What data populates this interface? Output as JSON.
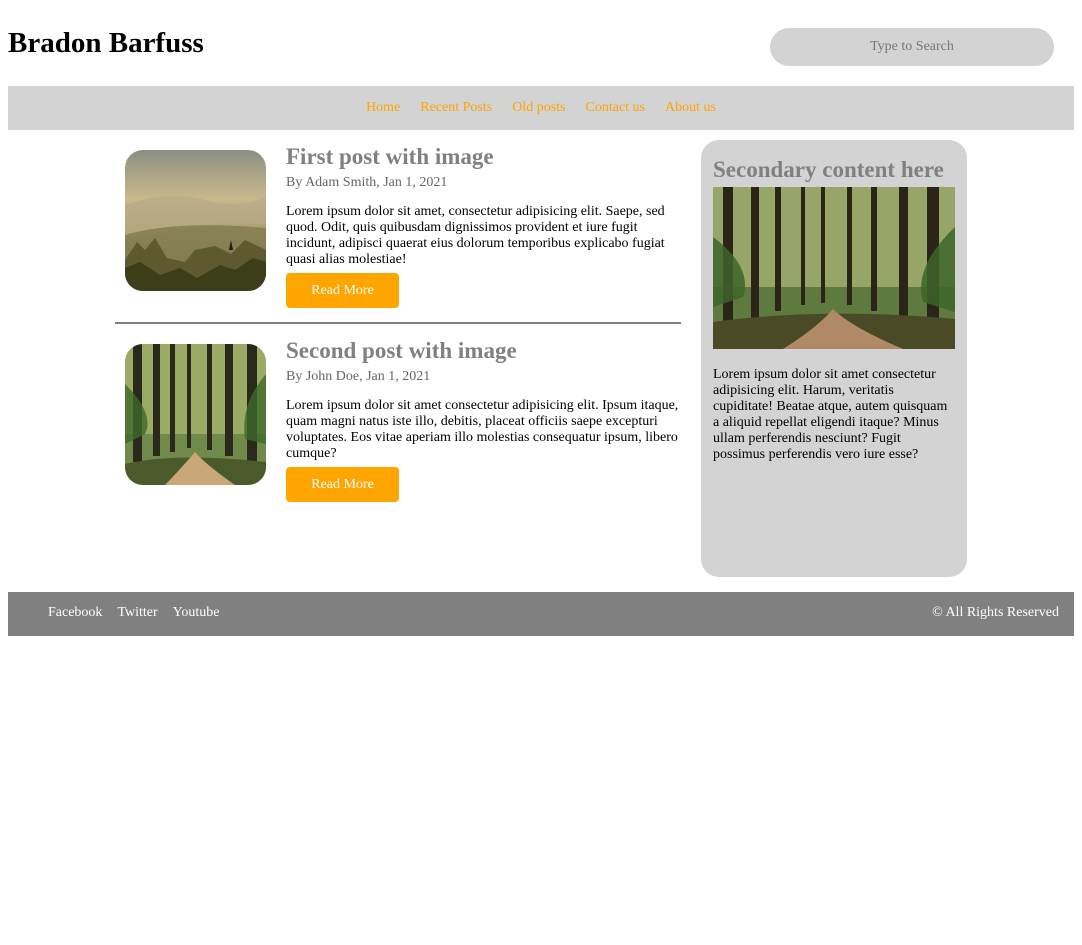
{
  "header": {
    "title": "Bradon Barfuss",
    "search_placeholder": "Type to Search"
  },
  "nav": {
    "items": [
      {
        "label": "Home"
      },
      {
        "label": "Recent Posts"
      },
      {
        "label": "Old posts"
      },
      {
        "label": "Contact us"
      },
      {
        "label": "About us"
      }
    ]
  },
  "posts": [
    {
      "title": "First post with image",
      "meta": "By Adam Smith, Jan 1, 2021",
      "text": "Lorem ipsum dolor sit amet, consectetur adipisicing elit. Saepe, sed quod. Odit, quis quibusdam dignissimos provident et iure fugit incidunt, adipisci quaerat eius dolorum temporibus explicabo fugiat quasi alias molestiae!",
      "button": "Read More",
      "image_icon": "mountain-landscape"
    },
    {
      "title": "Second post with image",
      "meta": "By John Doe, Jan 1, 2021",
      "text": "Lorem ipsum dolor sit amet consectetur adipisicing elit. Ipsum itaque, quam magni natus iste illo, debitis, placeat officiis saepe excepturi voluptates. Eos vitae aperiam illo molestias consequatur ipsum, libero cumque?",
      "button": "Read More",
      "image_icon": "forest-path"
    }
  ],
  "aside": {
    "title": "Secondary content here",
    "text": "Lorem ipsum dolor sit amet consectetur adipisicing elit. Harum, veritatis cupiditate! Beatae atque, autem quisquam a aliquid repellat eligendi itaque? Minus ullam perferendis nesciunt? Fugit possimus perferendis vero iure esse?",
    "image_icon": "forest-path"
  },
  "footer": {
    "links": [
      {
        "label": "Facebook"
      },
      {
        "label": "Twitter"
      },
      {
        "label": "Youtube"
      }
    ],
    "copyright": "© All Rights Reserved"
  },
  "colors": {
    "accent": "#ffa500",
    "nav_bg": "#d3d3d3",
    "footer_bg": "#808080",
    "heading_gray": "#808080"
  }
}
